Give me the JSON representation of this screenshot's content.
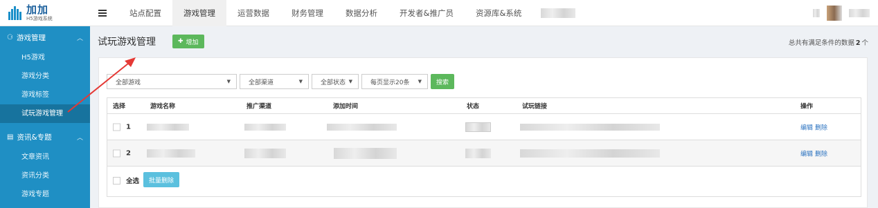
{
  "logo": {
    "title": "加加",
    "subtitle": "H5游戏系统"
  },
  "nav": {
    "items": [
      "站点配置",
      "游戏管理",
      "运营数据",
      "财务管理",
      "数据分析",
      "开发者&推广员",
      "资源库&系统"
    ],
    "active_index": 1
  },
  "sidebar": {
    "group1": {
      "label": "游戏管理",
      "items": [
        "H5游戏",
        "游戏分类",
        "游戏标签",
        "试玩游戏管理"
      ]
    },
    "group2": {
      "label": "资讯&专题",
      "items": [
        "文章资讯",
        "资讯分类",
        "游戏专题"
      ]
    },
    "active_item": "试玩游戏管理"
  },
  "page": {
    "title": "试玩游戏管理",
    "add_label": "增加",
    "count_prefix": "总共有满足条件的数据",
    "count_value": "2",
    "count_suffix": "个"
  },
  "filters": {
    "game": "全部游戏",
    "channel": "全部渠道",
    "status": "全部状态",
    "per_page": "每页显示20条",
    "search_label": "搜索"
  },
  "table": {
    "headers": [
      "选择",
      "游戏名称",
      "推广渠道",
      "添加时间",
      "状态",
      "试玩链接",
      "操作"
    ],
    "rows": [
      {
        "index": "1",
        "edit": "编辑",
        "delete": "删除"
      },
      {
        "index": "2",
        "edit": "编辑",
        "delete": "删除"
      }
    ],
    "select_all": "全选",
    "bulk_delete": "批量删除"
  },
  "colors": {
    "sidebar": "#1f8fc4",
    "accent_green": "#5cb85c",
    "info_blue": "#5bc0de",
    "arrow_red": "#e53935"
  }
}
